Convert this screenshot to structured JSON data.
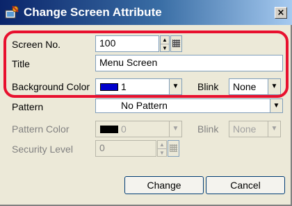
{
  "window": {
    "title": "Change Screen Attribute",
    "close_glyph": "×"
  },
  "screen_no": {
    "label": "Screen No.",
    "value": "100"
  },
  "title_field": {
    "label": "Title",
    "value": "Menu Screen"
  },
  "background_color": {
    "label": "Background Color",
    "value": "1",
    "swatch": "#0000cc"
  },
  "blink1": {
    "label": "Blink",
    "value": "None"
  },
  "pattern": {
    "label": "Pattern",
    "value": "No Pattern"
  },
  "pattern_color": {
    "label": "Pattern Color",
    "value": "0",
    "swatch": "#000000"
  },
  "blink2": {
    "label": "Blink",
    "value": "None"
  },
  "security_level": {
    "label": "Security Level",
    "value": "0"
  },
  "buttons": {
    "change": "Change",
    "cancel": "Cancel"
  },
  "colors": {
    "highlight": "#e8102e",
    "titlebar_start": "#0a246a",
    "titlebar_end": "#a6caf0"
  },
  "icons": {
    "title": "screen-attribute-icon",
    "spin": "spin-arrows-icon",
    "grid": "keypad-grid-icon",
    "dropdown": "chevron-down-icon"
  }
}
